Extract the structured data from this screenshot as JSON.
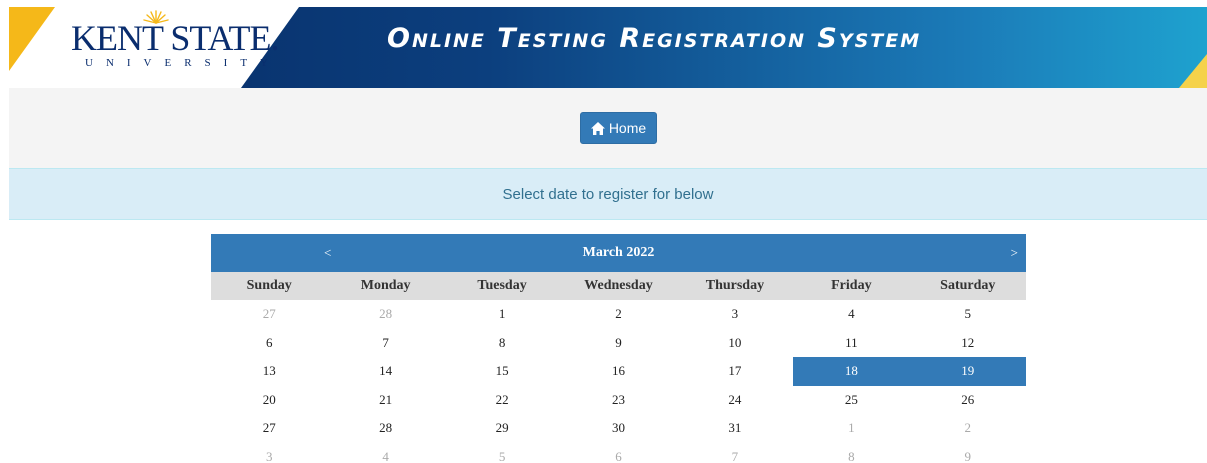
{
  "header": {
    "logo_wordmark": "KENT STATE.",
    "logo_subtitle": "UNIVERSITY",
    "title": "Online Testing Registration System"
  },
  "nav": {
    "home_label": "Home"
  },
  "info": {
    "message": "Select date to register for below"
  },
  "calendar": {
    "month_label": "March 2022",
    "prev_label": "<",
    "next_label": ">",
    "weekdays": [
      "Sunday",
      "Monday",
      "Tuesday",
      "Wednesday",
      "Thursday",
      "Friday",
      "Saturday"
    ],
    "days": [
      {
        "label": "27",
        "other": true
      },
      {
        "label": "28",
        "other": true
      },
      {
        "label": "1"
      },
      {
        "label": "2"
      },
      {
        "label": "3"
      },
      {
        "label": "4"
      },
      {
        "label": "5"
      },
      {
        "label": "6"
      },
      {
        "label": "7"
      },
      {
        "label": "8"
      },
      {
        "label": "9"
      },
      {
        "label": "10"
      },
      {
        "label": "11"
      },
      {
        "label": "12"
      },
      {
        "label": "13"
      },
      {
        "label": "14"
      },
      {
        "label": "15"
      },
      {
        "label": "16"
      },
      {
        "label": "17"
      },
      {
        "label": "18",
        "selected": true
      },
      {
        "label": "19",
        "selected": true
      },
      {
        "label": "20"
      },
      {
        "label": "21"
      },
      {
        "label": "22"
      },
      {
        "label": "23"
      },
      {
        "label": "24"
      },
      {
        "label": "25"
      },
      {
        "label": "26"
      },
      {
        "label": "27"
      },
      {
        "label": "28"
      },
      {
        "label": "29"
      },
      {
        "label": "30"
      },
      {
        "label": "31"
      },
      {
        "label": "1",
        "other": true
      },
      {
        "label": "2",
        "other": true
      },
      {
        "label": "3",
        "other": true
      },
      {
        "label": "4",
        "other": true
      },
      {
        "label": "5",
        "other": true
      },
      {
        "label": "6",
        "other": true
      },
      {
        "label": "7",
        "other": true
      },
      {
        "label": "8",
        "other": true
      },
      {
        "label": "9",
        "other": true
      }
    ]
  },
  "colors": {
    "primary": "#337ab7",
    "banner_dark": "#062a63",
    "banner_light": "#1ea2cf",
    "gold": "#f5b819",
    "info_bg": "#d9edf7",
    "info_text": "#31708f"
  },
  "icons": {
    "home": "home-icon",
    "logo_sun": "sunburst-icon"
  }
}
